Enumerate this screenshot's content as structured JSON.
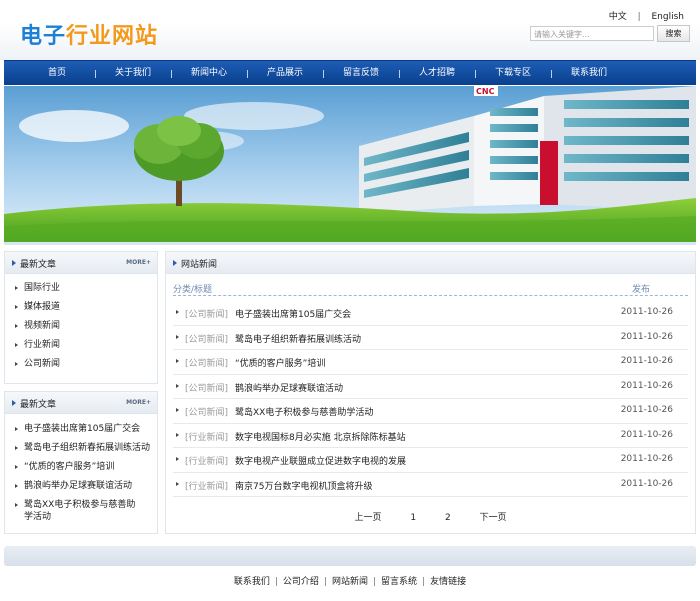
{
  "header": {
    "logo_part1": "电子",
    "logo_part2": "行业网站",
    "lang_cn": "中文",
    "lang_sep": "|",
    "lang_en": "English",
    "search_placeholder": "请输入关键字...",
    "search_button": "搜索"
  },
  "nav": [
    "首页",
    "关于我们",
    "新闻中心",
    "产品展示",
    "留言反馈",
    "人才招聘",
    "下载专区",
    "联系我们"
  ],
  "banner": {
    "building_sign": "CNC"
  },
  "sidebar_box1": {
    "title": "最新文章",
    "more": "MORE+",
    "items": [
      "国际行业",
      "媒体报道",
      "视频新闻",
      "行业新闻",
      "公司新闻"
    ]
  },
  "sidebar_box2": {
    "title": "最新文章",
    "more": "MORE+",
    "items": [
      "电子盛装出席第105届广交会",
      "鹭岛电子组织新春拓展训练活动",
      "“优质的客户服务”培训",
      "鹊浪屿举办足球赛联谊活动",
      "鹭岛XX电子积极参与慈善助学活动"
    ]
  },
  "main": {
    "title": "网站新闻",
    "col_category_title": "分类/标题",
    "col_publish": "发布",
    "rows": [
      {
        "category": "[公司新闻]",
        "title": "电子盛装出席第105届广交会",
        "date": "2011-10-26"
      },
      {
        "category": "[公司新闻]",
        "title": "鹭岛电子组织新春拓展训练活动",
        "date": "2011-10-26"
      },
      {
        "category": "[公司新闻]",
        "title": "“优质的客户服务”培训",
        "date": "2011-10-26"
      },
      {
        "category": "[公司新闻]",
        "title": "鹊浪屿举办足球赛联谊活动",
        "date": "2011-10-26"
      },
      {
        "category": "[公司新闻]",
        "title": "鹭岛XX电子积极参与慈善助学活动",
        "date": "2011-10-26"
      },
      {
        "category": "[行业新闻]",
        "title": "数字电视国标8月必实施 北京拆除陈标基站",
        "date": "2011-10-26"
      },
      {
        "category": "[行业新闻]",
        "title": "数字电视产业联盟成立促进数字电视的发展",
        "date": "2011-10-26"
      },
      {
        "category": "[行业新闻]",
        "title": "南京75万台数字电视机顶盒将升级",
        "date": "2011-10-26"
      }
    ],
    "pager": {
      "prev": "上一页",
      "page1": "1",
      "page2": "2",
      "next": "下一页"
    }
  },
  "footer": {
    "links": [
      "联系我们",
      "公司介绍",
      "网站新闻",
      "留言系统",
      "友情链接"
    ],
    "sep": "|"
  }
}
